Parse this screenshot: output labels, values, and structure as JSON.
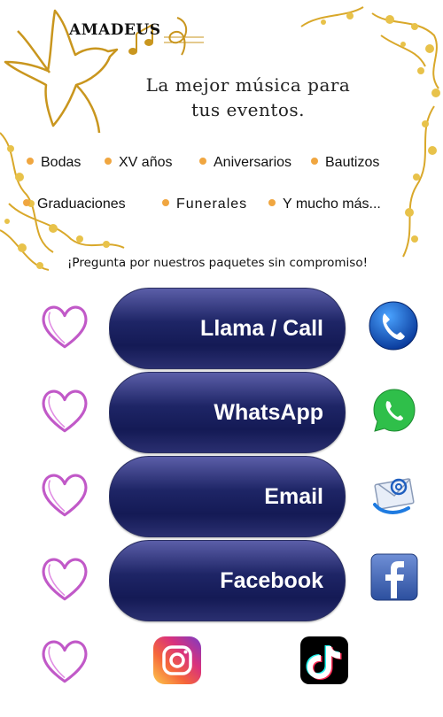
{
  "brand": {
    "name": "AMADEUS"
  },
  "tagline": {
    "line1": "La mejor música para",
    "line2": "tus eventos."
  },
  "services": [
    "Bodas",
    "XV años",
    "Aniversarios",
    "Bautizos",
    "Graduaciones",
    "Funerales",
    "Y mucho más..."
  ],
  "promo": "¡Pregunta por nuestros paquetes sin compromiso!",
  "buttons": [
    {
      "label": "Llama / Call",
      "icon": "phone-icon"
    },
    {
      "label": "WhatsApp",
      "icon": "whatsapp-icon"
    },
    {
      "label": "Email",
      "icon": "email-icon"
    },
    {
      "label": "Facebook",
      "icon": "facebook-icon"
    }
  ],
  "bottom_icons": [
    "instagram-icon",
    "tiktok-icon"
  ],
  "colors": {
    "pill": "#1e2566",
    "gold": "#d9a82a",
    "heart": "#c159c8",
    "bullet": "#f0a640"
  }
}
